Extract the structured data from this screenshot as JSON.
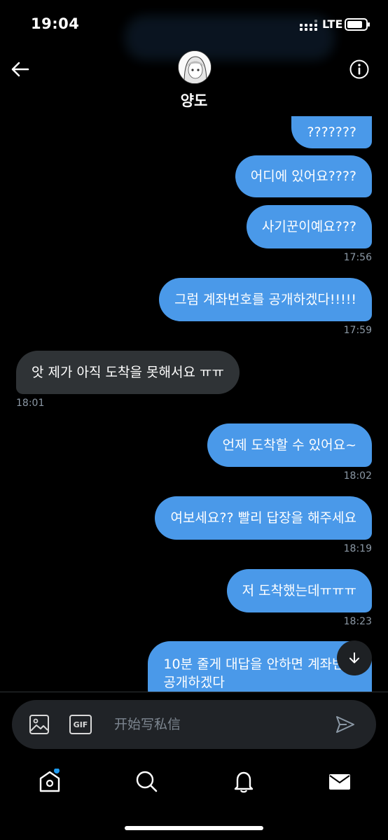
{
  "status": {
    "time": "19:04",
    "network": "LTE",
    "battery_level": 0.85
  },
  "header": {
    "name": "양도"
  },
  "messages": [
    {
      "dir": "out",
      "text": "???????"
    },
    {
      "dir": "out",
      "text": "어디에 있어요????"
    },
    {
      "dir": "out",
      "text": "사기꾼이예요???",
      "time": "17:56"
    },
    {
      "dir": "out",
      "text": "그럼 계좌번호를 공개하겠다!!!!!",
      "time": "17:59"
    },
    {
      "dir": "in",
      "text": "앗 제가 아직 도착을 못해서요 ㅠㅠ",
      "time": "18:01"
    },
    {
      "dir": "out",
      "text": "언제 도착할 수 있어요~",
      "time": "18:02"
    },
    {
      "dir": "out",
      "text": "여보세요?? 빨리 답장을 해주세요",
      "time": "18:19"
    },
    {
      "dir": "out",
      "text": "저 도착했는데ㅠㅠㅠ",
      "time": "18:23"
    },
    {
      "dir": "out",
      "text": "10분 줄게 대답을 안하면 계좌번호",
      "text2": "공개하겠다"
    }
  ],
  "composer": {
    "placeholder": "开始写私信",
    "gif_label": "GIF"
  },
  "tabs": [
    "home-icon",
    "search-icon",
    "bell-icon",
    "mail-icon"
  ],
  "colors": {
    "outgoing": "#4a99e9",
    "incoming": "#2f3336",
    "notification_dot": "#1d9bf0"
  }
}
